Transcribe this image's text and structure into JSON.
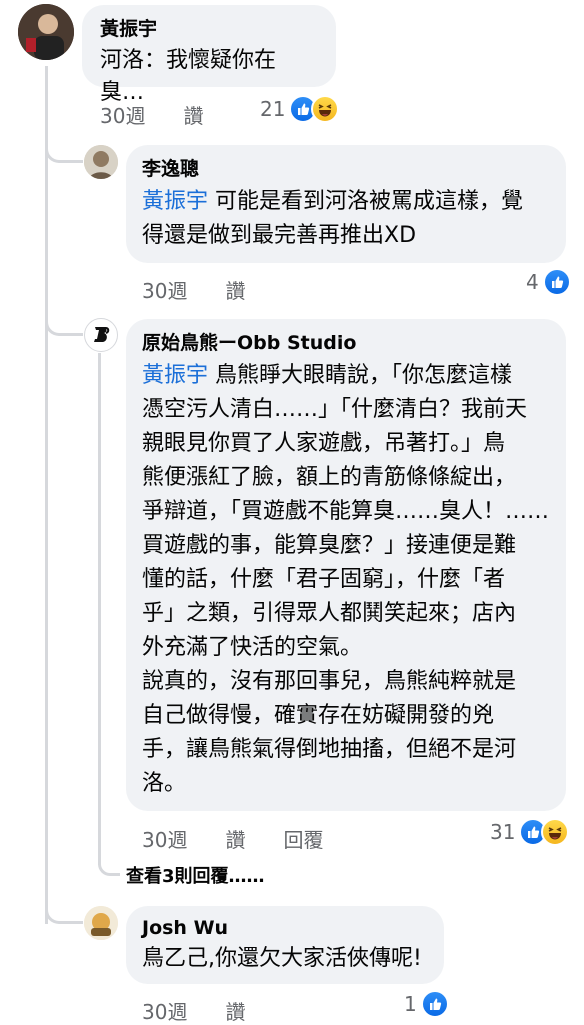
{
  "comments": [
    {
      "author": "黃振宇",
      "text": "河洛：我懷疑你在臭…",
      "time": "30週",
      "like_label": "讚",
      "reaction_count": "21"
    },
    {
      "author": "李逸聰",
      "mention": "黃振宇",
      "line1": " 可能是看到河洛被罵成這樣，覺",
      "line2": "得還是做到最完善再推出XD",
      "time": "30週",
      "like_label": "讚",
      "reaction_count": "4"
    },
    {
      "author": "原始鳥熊ーObb Studio",
      "mention": "黃振宇",
      "lines": [
        " 鳥熊睜大眼睛說，「你怎麼這樣",
        "憑空污人清白……」「什麼清白？我前天",
        "親眼見你買了人家遊戲，吊著打。」鳥",
        "熊便漲紅了臉，額上的青筋條條綻出，",
        "爭辯道，「買遊戲不能算臭……臭人！……",
        "買遊戲的事，能算臭麼？」接連便是難",
        "懂的話，什麼「君子固窮」，什麼「者",
        "乎」之類，引得眾人都鬨笑起來；店內",
        "外充滿了快活的空氣。",
        "說真的，沒有那回事兒，鳥熊純粹就是",
        "自己做得慢，確實存在妨礙開發的兇",
        "手，讓鳥熊氣得倒地抽搐，但絕不是河",
        "洛。"
      ],
      "time": "30週",
      "like_label": "讚",
      "reply_label": "回覆",
      "reaction_count": "31"
    },
    {
      "author": "Josh Wu",
      "text": "鳥乙己,你還欠大家活俠傳呢!",
      "time": "30週",
      "like_label": "讚",
      "reaction_count": "1"
    }
  ],
  "more_replies": "查看3則回覆……",
  "colors": {
    "bubble": "#f0f2f5",
    "mention": "#1b6fd8",
    "meta": "#65676b",
    "like_blue": "#0a6ae6"
  }
}
